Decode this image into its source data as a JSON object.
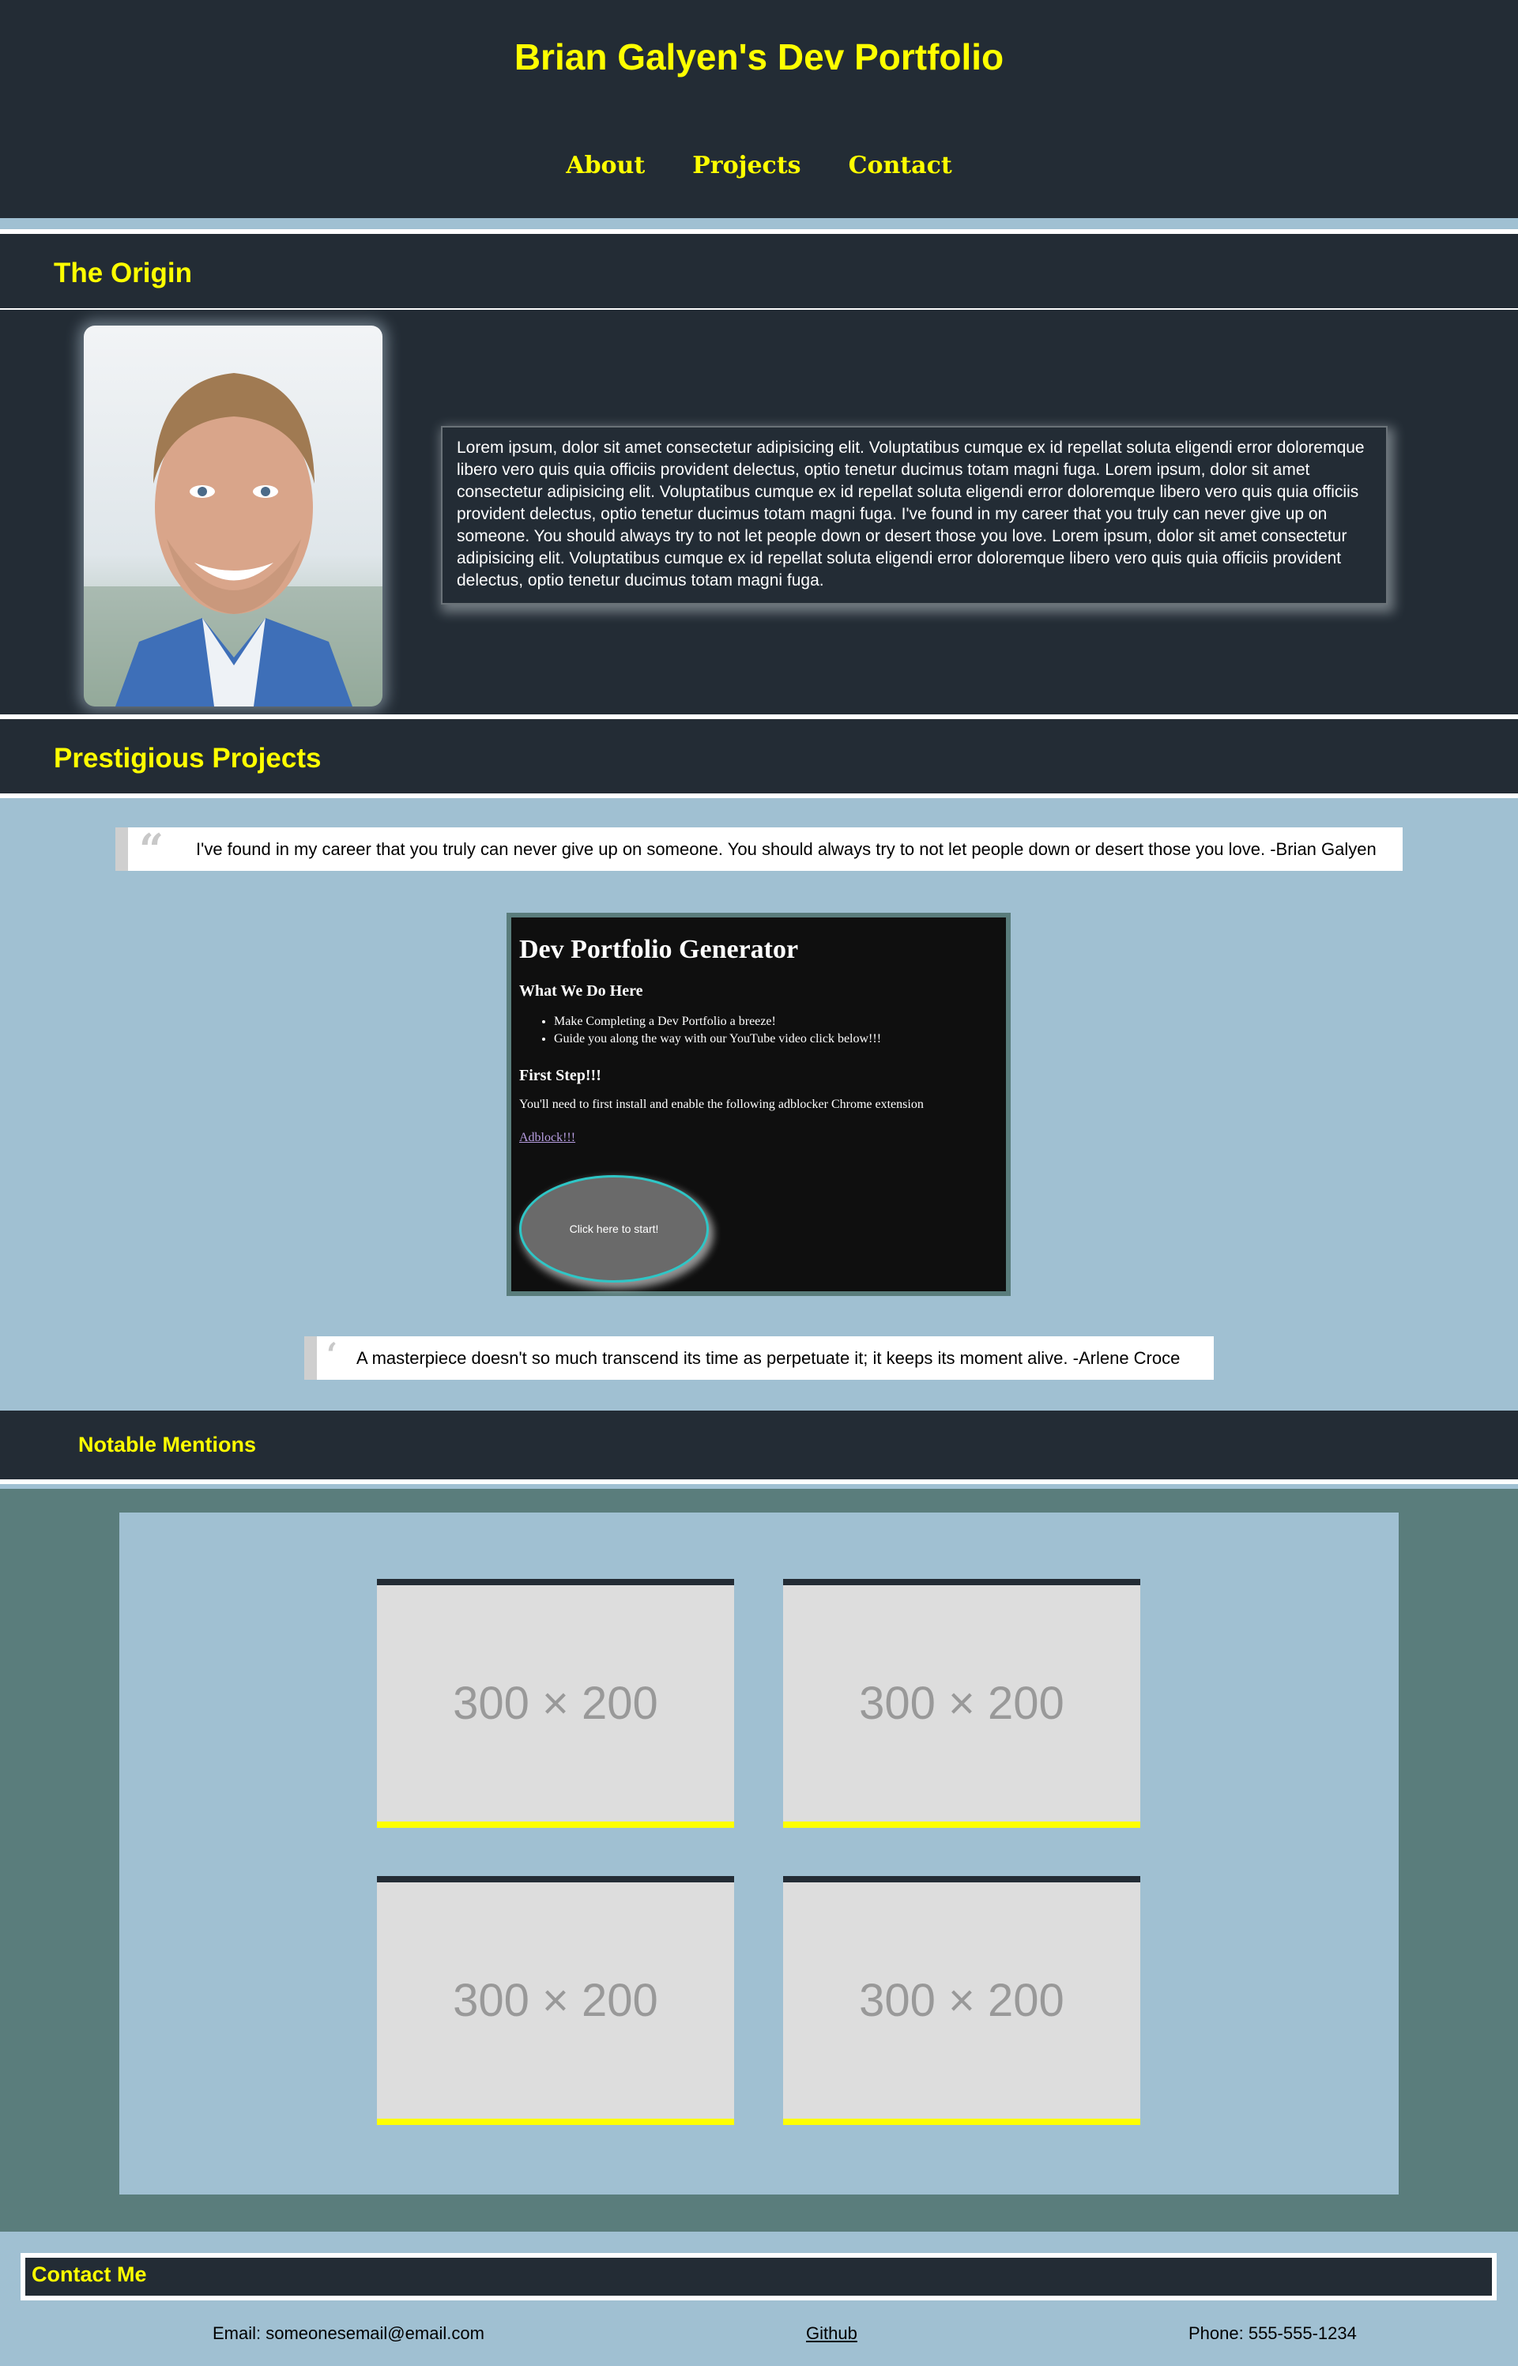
{
  "header": {
    "title": "Brian Galyen's Dev Portfolio",
    "nav": [
      "About",
      "Projects",
      "Contact"
    ]
  },
  "origin": {
    "heading": "The Origin",
    "bio": "Lorem ipsum, dolor sit amet consectetur adipisicing elit. Voluptatibus cumque ex id repellat soluta eligendi error doloremque libero vero quis quia officiis provident delectus, optio tenetur ducimus totam magni fuga. Lorem ipsum, dolor sit amet consectetur adipisicing elit. Voluptatibus cumque ex id repellat soluta eligendi error doloremque libero vero quis quia officiis provident delectus, optio tenetur ducimus totam magni fuga. I've found in my career that you truly can never give up on someone. You should always try to not let people down or desert those you love. Lorem ipsum, dolor sit amet consectetur adipisicing elit. Voluptatibus cumque ex id repellat soluta eligendi error doloremque libero vero quis quia officiis provident delectus, optio tenetur ducimus totam magni fuga."
  },
  "projects": {
    "heading": "Prestigious Projects",
    "quote1": "I've found in my career that you truly can never give up on someone. You should always try to not let people down or desert those you love. -Brian Galyen",
    "quote2": "A masterpiece doesn't so much transcend its time as perpetuate it; it keeps its moment alive. -Arlene Croce",
    "screenshot": {
      "title": "Dev Portfolio Generator",
      "subheading1": "What We Do Here",
      "bullets": [
        "Make Completing a Dev Portfolio a breeze!",
        "Guide you along the way with our YouTube video click below!!!"
      ],
      "subheading2": "First Step!!!",
      "instruction": "You'll need to first install and enable the following adblocker Chrome extension",
      "link": "Adblock!!!",
      "button": "Click here to start!"
    }
  },
  "mentions": {
    "heading": "Notable Mentions",
    "placeholder_label": "300 × 200"
  },
  "contact": {
    "heading": "Contact Me",
    "email": "Email: someonesemail@email.com",
    "github": "Github",
    "phone": "Phone: 555-555-1234"
  }
}
